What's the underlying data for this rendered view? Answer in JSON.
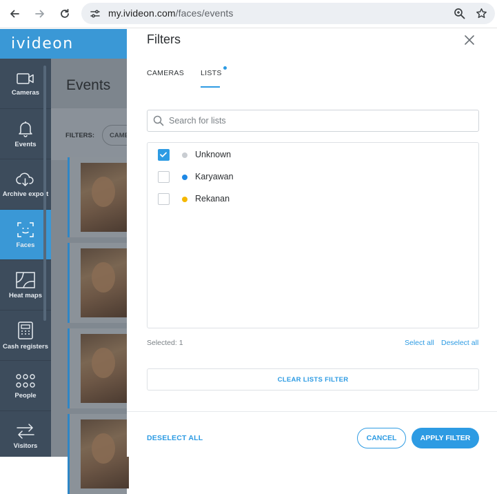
{
  "browser": {
    "url_domain": "my.ivideon.com",
    "url_path": "/faces/events"
  },
  "app": {
    "logo": "ivideon",
    "sidebar": [
      {
        "label": "Cameras",
        "icon": "camera-icon",
        "active": false
      },
      {
        "label": "Events",
        "icon": "bell-icon",
        "active": false
      },
      {
        "label": "Archive export",
        "icon": "cloud-download-icon",
        "active": false
      },
      {
        "label": "Faces",
        "icon": "face-scan-icon",
        "active": true
      },
      {
        "label": "Heat maps",
        "icon": "heat-map-icon",
        "active": false
      },
      {
        "label": "Cash registers",
        "icon": "cash-register-icon",
        "active": false
      },
      {
        "label": "People",
        "icon": "people-icon",
        "active": false
      },
      {
        "label": "Visitors",
        "icon": "visitors-icon",
        "active": false
      }
    ],
    "events": {
      "title": "Events",
      "filters_label": "FILTERS:",
      "chip_label": "CAME"
    }
  },
  "modal": {
    "title": "Filters",
    "tabs": [
      {
        "label": "CAMERAS",
        "active": false
      },
      {
        "label": "LISTS",
        "active": true
      }
    ],
    "search_placeholder": "Search for lists",
    "lists": [
      {
        "label": "Unknown",
        "checked": true,
        "color": "#c9cdd2"
      },
      {
        "label": "Karyawan",
        "checked": false,
        "color": "#1e88e5"
      },
      {
        "label": "Rekanan",
        "checked": false,
        "color": "#f5b800"
      }
    ],
    "selected_text": "Selected: 1",
    "select_all": "Select all",
    "deselect_all_link": "Deselect all",
    "clear_button": "CLEAR LISTS FILTER",
    "deselect_all_button": "DESELECT ALL",
    "cancel_button": "CANCEL",
    "apply_button": "APPLY FILTER"
  },
  "colors": {
    "accent": "#2d9be3",
    "sidebar": "#3d4c5c",
    "header": "#3a98d6"
  }
}
